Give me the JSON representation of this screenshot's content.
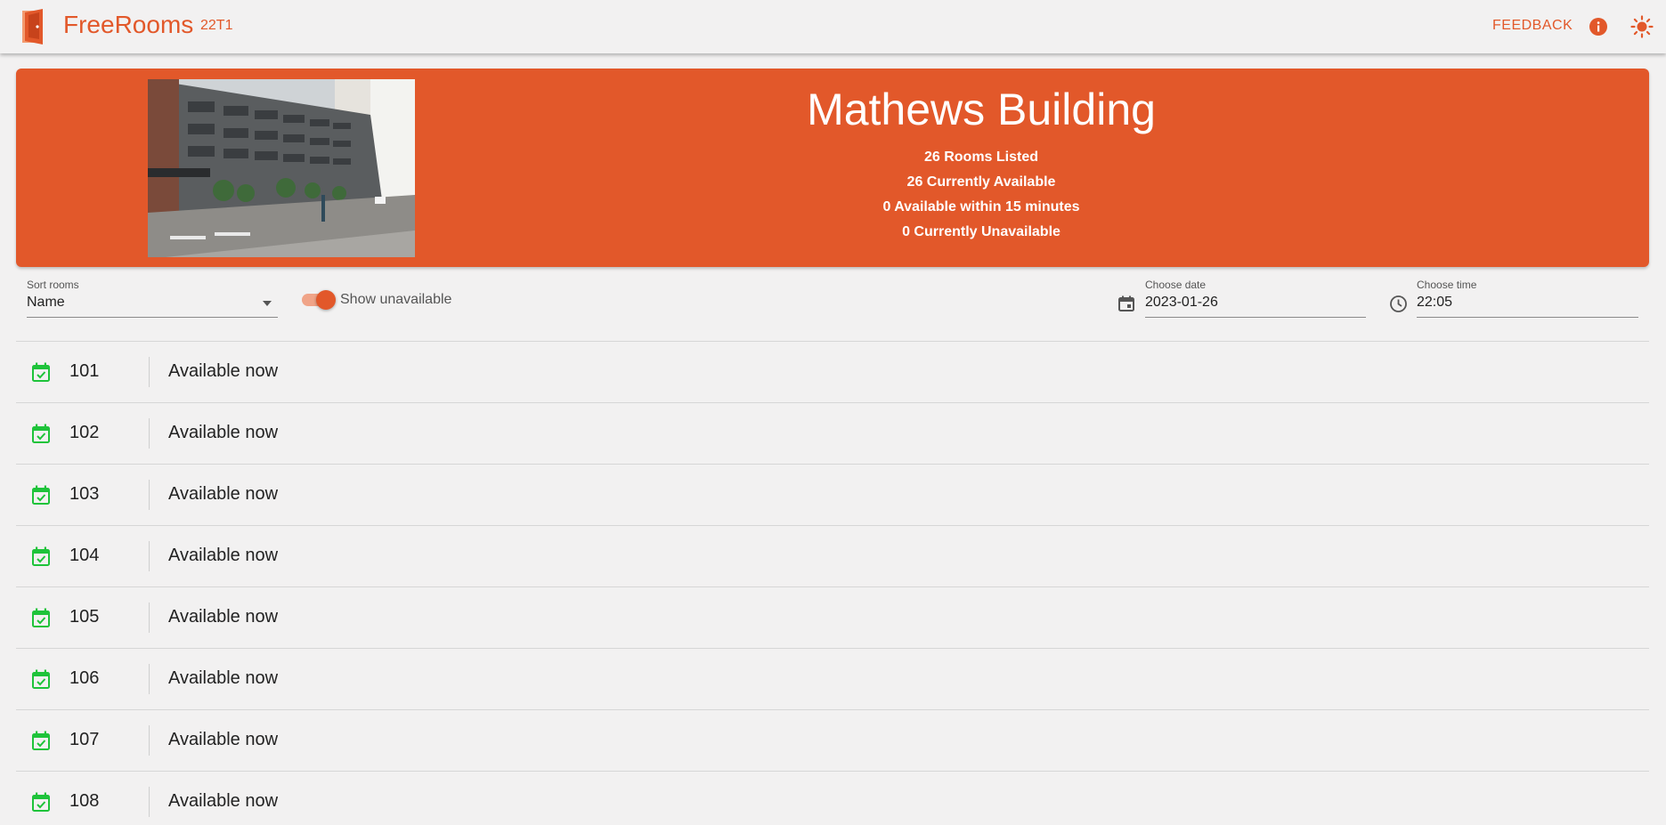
{
  "app": {
    "name": "FreeRooms",
    "term": "22T1",
    "feedback_label": "FEEDBACK",
    "accent_color": "#e2582a",
    "icons": {
      "logo": "door-icon",
      "info": "info-icon",
      "theme": "sun-icon"
    }
  },
  "building": {
    "name": "Mathews Building",
    "stats": [
      "26 Rooms Listed",
      "26 Currently Available",
      "0 Available within 15 minutes",
      "0 Currently Unavailable"
    ]
  },
  "controls": {
    "sort": {
      "label": "Sort rooms",
      "value": "Name"
    },
    "show_unavailable": {
      "label": "Show unavailable",
      "checked": true
    },
    "date": {
      "label": "Choose date",
      "value": "2023-01-26",
      "icon": "calendar-icon"
    },
    "time": {
      "label": "Choose time",
      "value": "22:05",
      "icon": "clock-icon"
    }
  },
  "rooms": [
    {
      "name": "101",
      "status": "Available now",
      "status_color": "#1ec33a"
    },
    {
      "name": "102",
      "status": "Available now",
      "status_color": "#1ec33a"
    },
    {
      "name": "103",
      "status": "Available now",
      "status_color": "#1ec33a"
    },
    {
      "name": "104",
      "status": "Available now",
      "status_color": "#1ec33a"
    },
    {
      "name": "105",
      "status": "Available now",
      "status_color": "#1ec33a"
    },
    {
      "name": "106",
      "status": "Available now",
      "status_color": "#1ec33a"
    },
    {
      "name": "107",
      "status": "Available now",
      "status_color": "#1ec33a"
    },
    {
      "name": "108",
      "status": "Available now",
      "status_color": "#1ec33a"
    }
  ]
}
